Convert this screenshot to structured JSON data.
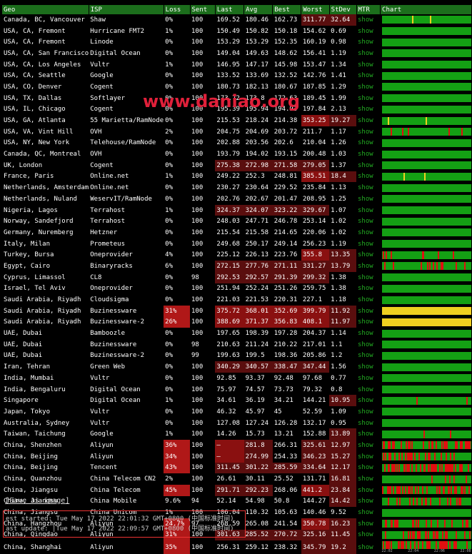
{
  "headers": [
    "Geo",
    "ISP",
    "Loss",
    "Sent",
    "Last",
    "Avg",
    "Best",
    "Worst",
    "StDev",
    "MTR",
    "Chart"
  ],
  "rows": [
    [
      "Canada, BC, Vancouver",
      "Shaw",
      "0%",
      "100",
      "169.52",
      "180.46",
      "162.73",
      "311.77",
      "32.64"
    ],
    [
      "USA, CA, Fremont",
      "Hurricane FMT2",
      "1%",
      "100",
      "150.49",
      "150.82",
      "150.18",
      "154.62",
      "0.69"
    ],
    [
      "USA, CA, Fremont",
      "Linode",
      "0%",
      "100",
      "153.29",
      "153.29",
      "152.35",
      "160.19",
      "0.98"
    ],
    [
      "USA, CA, San Francisco",
      "Digital Ocean",
      "0%",
      "100",
      "149.04",
      "149.63",
      "148.62",
      "156.41",
      "1.19"
    ],
    [
      "USA, CA, Los Angeles",
      "Vultr",
      "1%",
      "100",
      "146.95",
      "147.17",
      "145.98",
      "153.47",
      "1.34"
    ],
    [
      "USA, CA, Seattle",
      "Google",
      "0%",
      "100",
      "133.52",
      "133.69",
      "132.52",
      "142.76",
      "1.41"
    ],
    [
      "USA, CO, Denver",
      "Cogent",
      "0%",
      "100",
      "180.73",
      "182.13",
      "180.67",
      "187.85",
      "1.29"
    ],
    [
      "USA, TX, Dallas",
      "Softlayer",
      "0%",
      "100",
      "173.72",
      "173.8",
      "172.63",
      "189.45",
      "1.99"
    ],
    [
      "USA, IL, Chicago",
      "Cogent",
      "0%",
      "100",
      "195.39",
      "195.94",
      "194.93",
      "197.84",
      "2.13"
    ],
    [
      "USA, GA, Atlanta",
      "55 Marietta/RamNode",
      "0%",
      "100",
      "215.53",
      "218.24",
      "214.38",
      "353.25",
      "19.27"
    ],
    [
      "USA, VA, Vint Hill",
      "OVH",
      "2%",
      "100",
      "204.75",
      "204.69",
      "203.72",
      "211.7",
      "1.17"
    ],
    [
      "USA, NY, New York",
      "Telehouse/RamNode",
      "0%",
      "100",
      "202.88",
      "203.56",
      "202.6",
      "210.04",
      "1.26"
    ],
    [
      "Canada, QC, Montreal",
      "OVH",
      "0%",
      "100",
      "193.79",
      "194.02",
      "193.15",
      "200.48",
      "1.03"
    ],
    [
      "UK, London",
      "Cogent",
      "0%",
      "100",
      "275.38",
      "272.98",
      "271.58",
      "279.05",
      "1.37"
    ],
    [
      "France, Paris",
      "Online.net",
      "1%",
      "100",
      "249.22",
      "252.3",
      "248.81",
      "385.51",
      "18.4"
    ],
    [
      "Netherlands, Amsterdam",
      "Online.net",
      "0%",
      "100",
      "230.27",
      "230.64",
      "229.52",
      "235.84",
      "1.13"
    ],
    [
      "Netherlands, Nuland",
      "WeservIT/RamNode",
      "0%",
      "100",
      "202.76",
      "202.67",
      "201.47",
      "208.95",
      "1.25"
    ],
    [
      "Nigeria, Lagos",
      "Terrahost",
      "1%",
      "100",
      "324.37",
      "324.07",
      "323.22",
      "329.67",
      "1.07"
    ],
    [
      "Norway, Sandefjord",
      "Terrahost",
      "0%",
      "100",
      "248.03",
      "247.71",
      "246.78",
      "253.14",
      "1.02"
    ],
    [
      "Germany, Nuremberg",
      "Hetzner",
      "0%",
      "100",
      "215.54",
      "215.58",
      "214.65",
      "220.06",
      "1.02"
    ],
    [
      "Italy, Milan",
      "Prometeus",
      "0%",
      "100",
      "249.68",
      "250.17",
      "249.14",
      "256.23",
      "1.19"
    ],
    [
      "Turkey, Bursa",
      "Oneprovider",
      "4%",
      "100",
      "225.12",
      "226.13",
      "223.76",
      "355.8",
      "13.35"
    ],
    [
      "Egypt, Cairo",
      "Binaryracks",
      "6%",
      "100",
      "272.15",
      "277.76",
      "271.11",
      "331.27",
      "13.79"
    ],
    [
      "Cyprus, Limassol",
      "CL8",
      "0%",
      "98",
      "292.53",
      "292.57",
      "291.39",
      "299.32",
      "1.38"
    ],
    [
      "Israel, Tel Aviv",
      "Oneprovider",
      "0%",
      "100",
      "251.94",
      "252.24",
      "251.26",
      "259.75",
      "1.38"
    ],
    [
      "Saudi Arabia, Riyadh",
      "Cloudsigma",
      "0%",
      "100",
      "221.03",
      "221.53",
      "220.31",
      "227.1",
      "1.18"
    ],
    [
      "Saudi Arabia, Riyadh",
      "Buzinessware",
      "31%",
      "100",
      "375.72",
      "368.01",
      "352.69",
      "399.79",
      "11.92"
    ],
    [
      "Saudi Arabia, Riyadh",
      "Buzinessware-2",
      "26%",
      "100",
      "388.69",
      "371.37",
      "356.83",
      "408.1",
      "11.97"
    ],
    [
      "UAE, Dubai",
      "Bamboozle",
      "0%",
      "100",
      "197.65",
      "198.39",
      "197.28",
      "204.37",
      "1.14"
    ],
    [
      "UAE, Dubai",
      "Buzinessware",
      "0%",
      "98",
      "210.63",
      "211.24",
      "210.22",
      "217.01",
      "1.1"
    ],
    [
      "UAE, Dubai",
      "Buzinessware-2",
      "0%",
      "99",
      "199.63",
      "199.5",
      "198.36",
      "205.86",
      "1.2"
    ],
    [
      "Iran, Tehran",
      "Green Web",
      "0%",
      "100",
      "340.29",
      "340.57",
      "338.47",
      "347.44",
      "1.56"
    ],
    [
      "India, Mumbai",
      "Vultr",
      "0%",
      "100",
      "92.85",
      "93.37",
      "92.48",
      "97.68",
      "0.77"
    ],
    [
      "India, Bengaluru",
      "Digital Ocean",
      "0%",
      "100",
      "75.97",
      "74.57",
      "73.73",
      "79.32",
      "0.8"
    ],
    [
      "Singapore",
      "Digital Ocean",
      "1%",
      "100",
      "34.61",
      "36.19",
      "34.21",
      "144.21",
      "10.95"
    ],
    [
      "Japan, Tokyo",
      "Vultr",
      "0%",
      "100",
      "46.32",
      "45.97",
      "45",
      "52.59",
      "1.09"
    ],
    [
      "Australia, Sydney",
      "Vultr",
      "0%",
      "100",
      "127.08",
      "127.24",
      "126.28",
      "132.17",
      "0.95"
    ],
    [
      "Taiwan, Taichung",
      "Google",
      "1%",
      "100",
      "14.26",
      "15.73",
      "13.21",
      "152.88",
      "13.89"
    ],
    [
      "China, Shenzhen",
      "Aliyun",
      "36%",
      "100",
      "–",
      "281.8",
      "266.31",
      "325.61",
      "12.97"
    ],
    [
      "China, Beijing",
      "Aliyun",
      "34%",
      "100",
      "–",
      "274.99",
      "254.33",
      "346.23",
      "15.27"
    ],
    [
      "China, Beijing",
      "Tencent",
      "43%",
      "100",
      "311.45",
      "301.22",
      "285.59",
      "334.64",
      "12.17"
    ],
    [
      "China, Quanzhou",
      "China Telecom CN2",
      "2%",
      "100",
      "26.61",
      "30.11",
      "25.52",
      "131.71",
      "16.81"
    ],
    [
      "China, Jiangsu",
      "China Telecom",
      "45%",
      "100",
      "291.71",
      "292.23",
      "268.06",
      "441.2",
      "23.84"
    ],
    [
      "China, Jiangsu",
      "China Mobile",
      "9.6%",
      "94",
      "52.14",
      "54.98",
      "50.8",
      "144.27",
      "14.42"
    ],
    [
      "China, Jiangsu",
      "China Unicom",
      "1%",
      "100",
      "106.04",
      "110.32",
      "105.63",
      "140.46",
      "9.52"
    ],
    [
      "China, Hangzhou",
      "Aliyun",
      "24.7%",
      "97",
      "268.59",
      "265.08",
      "241.54",
      "350.78",
      "16.23"
    ],
    [
      "China, Qingdao",
      "Aliyun",
      "31%",
      "100",
      "301.63",
      "285.52",
      "270.72",
      "325.16",
      "11.45"
    ],
    [
      "China, Shanghai",
      "Aliyun",
      "35%",
      "100",
      "256.31",
      "259.12",
      "238.32",
      "345.79",
      "19.2"
    ]
  ],
  "mtr_label": "show",
  "chart_axis": [
    "22:02",
    "22:04",
    "22:06",
    "22:08"
  ],
  "save_link": "Save as image",
  "status": {
    "started": "est started: Tue May 17 2022 22:01:32 GMT+0800 (中国标准时间)",
    "updated": "ast update: |Tue May 17 2022 22:09:57 GMT+0800 (中国标准时间)"
  },
  "watermark": "www.daniao.org",
  "colors": {
    "header_bg": "#1c6e1c",
    "bar_green": "#14a014",
    "loss_red": "#b01818",
    "latency_darkred": "#5a0e0e",
    "latency_red": "#8a1010",
    "spike_red": "#e01010",
    "spike_yellow": "#f0d020"
  }
}
